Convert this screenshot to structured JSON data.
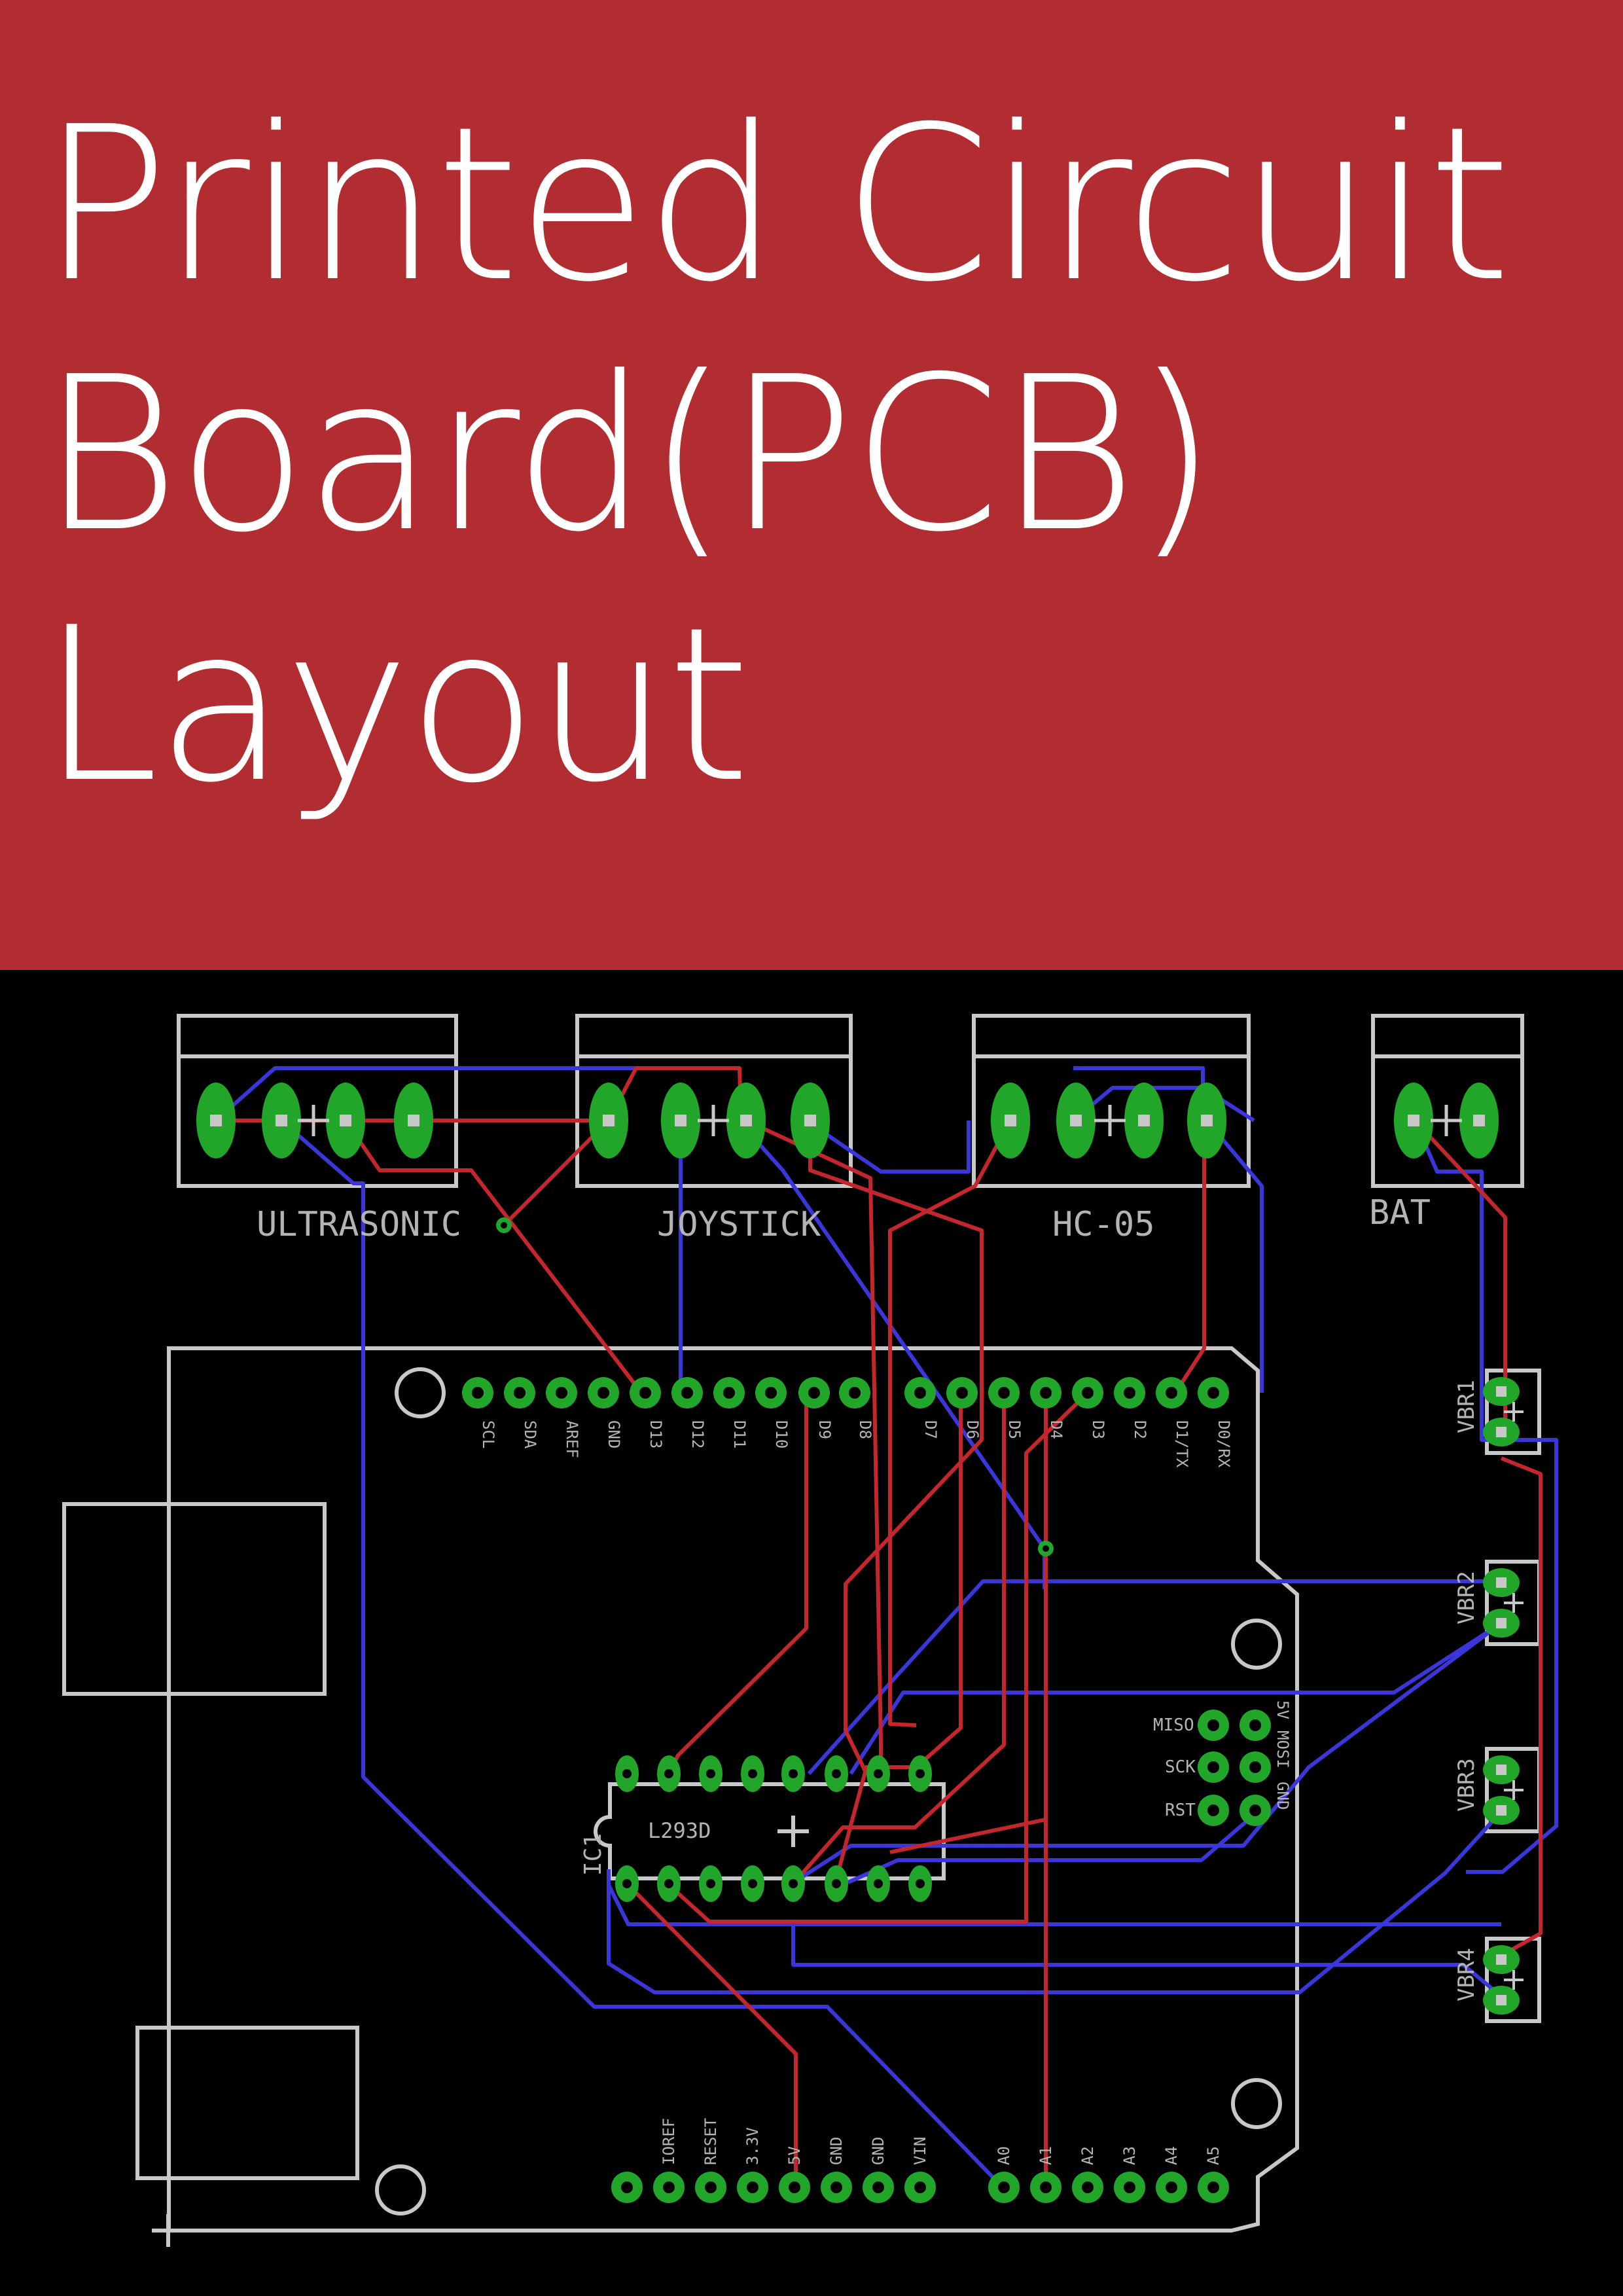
{
  "title": {
    "line1": "Printed Circuit",
    "line2": "Board(PCB)",
    "line3": "Layout"
  },
  "colors": {
    "banner": "#b22d31",
    "board_background": "#000000",
    "silkscreen": "#c8c8c8",
    "pad": "#22a62a",
    "top_trace": "#c3262c",
    "bottom_trace": "#3a36d9"
  },
  "connectors": [
    {
      "id": "ultrasonic",
      "label": "ULTRASONIC",
      "pins": 4
    },
    {
      "id": "joystick",
      "label": "JOYSTICK",
      "pins": 4
    },
    {
      "id": "hc05",
      "label": "HC-05",
      "pins": 4
    },
    {
      "id": "bat",
      "label": "BAT",
      "pins": 2
    }
  ],
  "vibration_motors": [
    {
      "id": "vbr1",
      "label": "VBR1"
    },
    {
      "id": "vbr2",
      "label": "VBR2"
    },
    {
      "id": "vbr3",
      "label": "VBR3"
    },
    {
      "id": "vbr4",
      "label": "VBR4"
    }
  ],
  "ic": {
    "ref": "IC1",
    "part": "L293D"
  },
  "digital_header": [
    "SCL",
    "SDA",
    "AREF",
    "GND",
    "D13",
    "D12",
    "D11",
    "D10",
    "D9",
    "D8",
    "D7",
    "D6",
    "D5",
    "D4",
    "D3",
    "D2",
    "D1/TX",
    "D0/RX"
  ],
  "power_header": [
    "",
    "IOREF",
    "RESET",
    "3.3V",
    "5V",
    "GND",
    "GND",
    "VIN"
  ],
  "analog_header": [
    "A0",
    "A1",
    "A2",
    "A3",
    "A4",
    "A5"
  ],
  "icsp_labels": [
    "MISO",
    "SCK",
    "RST",
    "5V",
    "MOSI",
    "GND"
  ]
}
